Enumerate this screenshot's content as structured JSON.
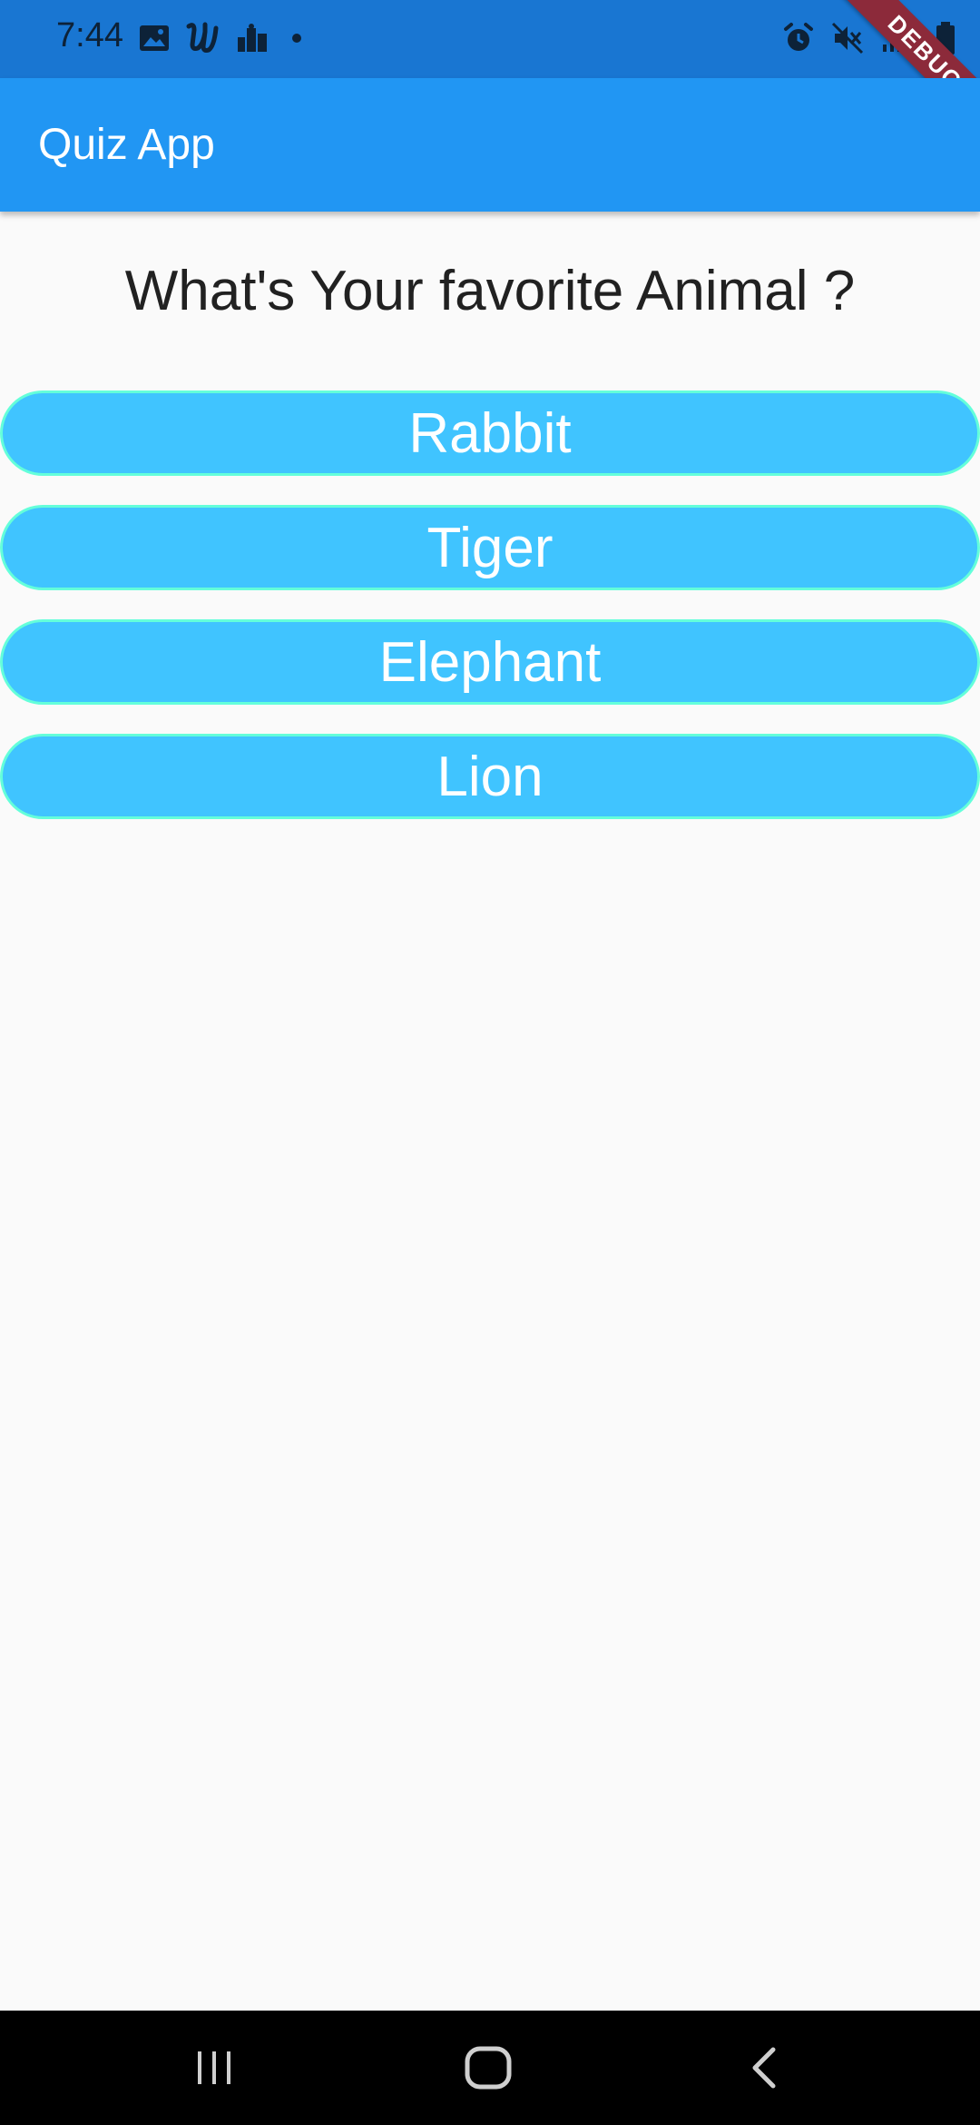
{
  "status_bar": {
    "time": "7:44",
    "left_icons": [
      "image-icon",
      "u-app-icon",
      "city-icon",
      "notification-dot"
    ],
    "right_icons": [
      "alarm-icon",
      "mute-icon",
      "signal-icon",
      "battery-icon"
    ],
    "debug_label": "DEBUG"
  },
  "app_bar": {
    "title": "Quiz App"
  },
  "quiz": {
    "question": "What's Your favorite Animal ?",
    "answers": [
      "Rabbit",
      "Tiger",
      "Elephant",
      "Lion"
    ]
  },
  "nav_bar": {
    "buttons": [
      "recent-apps-icon",
      "home-icon",
      "back-icon"
    ]
  },
  "colors": {
    "status_bar": "#1976d2",
    "app_bar": "#2196f3",
    "button": "#40c4ff",
    "button_border": "#64ffda",
    "background": "#fafafa"
  }
}
